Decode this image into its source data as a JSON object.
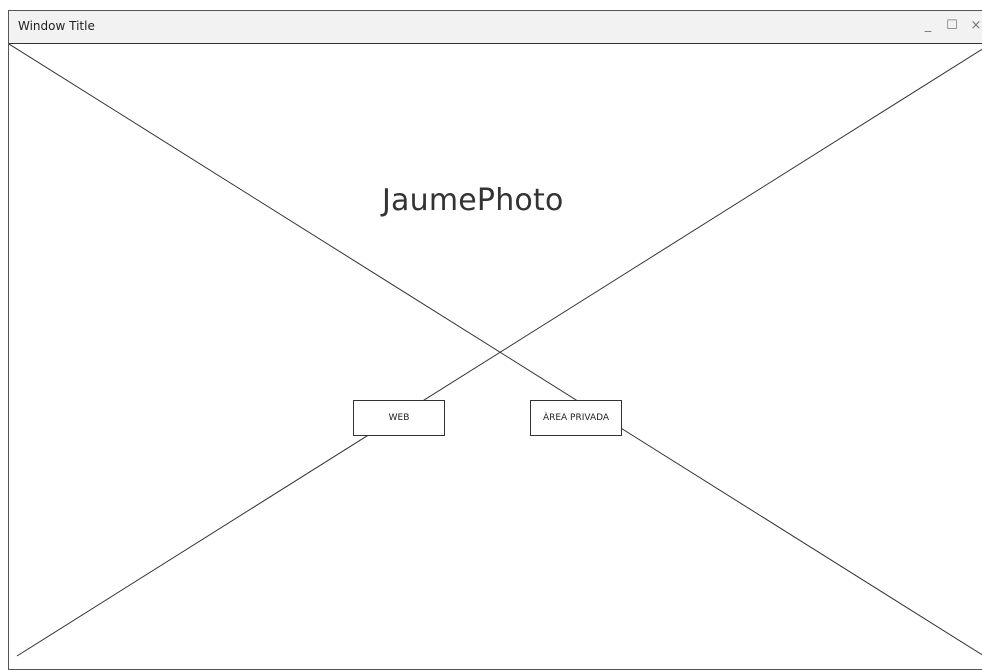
{
  "window": {
    "title": "Window Title",
    "controls": {
      "minimize": "_",
      "maximize": "☐",
      "close": "×"
    }
  },
  "main": {
    "app_title": "JaumePhoto",
    "buttons": {
      "web_label": "WEB",
      "private_area_label": "ÀREA PRIVADA"
    }
  },
  "colors": {
    "border": "#333333",
    "titlebar_bg": "#f2f2f2",
    "background": "#ffffff"
  }
}
